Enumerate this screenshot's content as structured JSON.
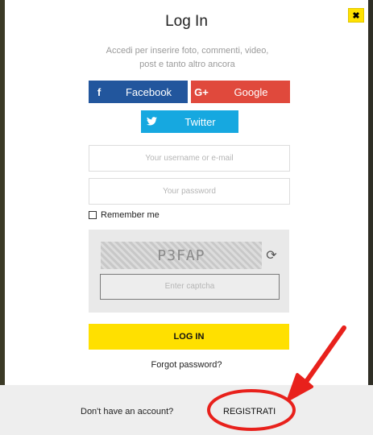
{
  "modal": {
    "close_icon": "close-icon",
    "title": "Log In",
    "subtitle_line1": "Accedi per inserire foto, commenti, video,",
    "subtitle_line2": "post e tanto altro ancora"
  },
  "social": {
    "facebook_label": "Facebook",
    "facebook_icon": "f",
    "google_label": "Google",
    "google_icon": "G+",
    "twitter_label": "Twitter",
    "twitter_icon": "twitter-bird-icon"
  },
  "form": {
    "username_placeholder": "Your username or e-mail",
    "password_placeholder": "Your password",
    "remember_label": "Remember me",
    "captcha_text": "P3FAP",
    "captcha_placeholder": "Enter captcha",
    "login_label": "LOG IN",
    "forgot_label": "Forgot password?"
  },
  "footer": {
    "no_account_text": "Don't have an account?",
    "register_label": "REGISTRATI"
  },
  "colors": {
    "facebook": "#22569d",
    "google": "#e0493c",
    "twitter": "#16a8e0",
    "accent_yellow": "#ffe000",
    "annotation_red": "#e8211c"
  }
}
